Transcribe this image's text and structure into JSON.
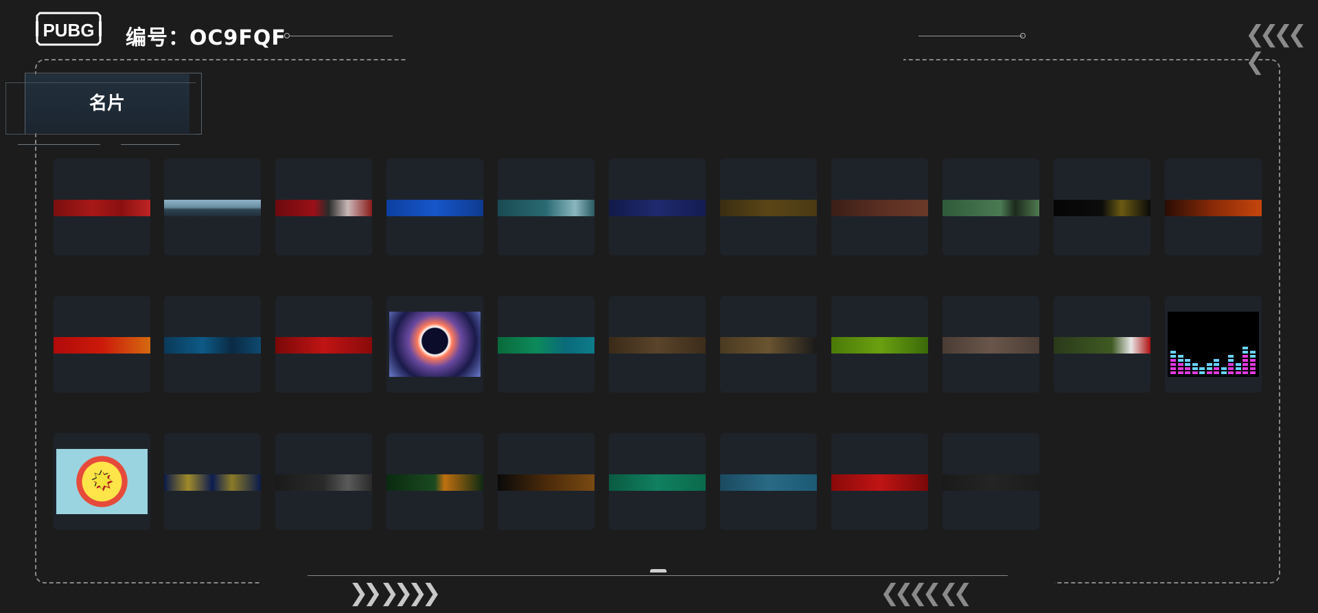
{
  "header": {
    "logo_text": "PUBG",
    "id_label": "编号：OC9FQF"
  },
  "section": {
    "title": "名片"
  },
  "cards": [
    {
      "name": "card-red-pattern",
      "style": "linear-gradient(90deg,#7a0f0f,#a81818 40%,#8a1010 70%,#c02424)"
    },
    {
      "name": "card-mountain",
      "style": "linear-gradient(180deg,#8fb3c8 0%,#6a8fa3 45%,#2f4350 60%,#1f2e38 100%)"
    },
    {
      "name": "card-red-dragon",
      "style": "linear-gradient(90deg,#6b0a0e,#9a1018 40%,#2a2a2a 55%,#c9b7b7 75%,#8a1a1a)"
    },
    {
      "name": "card-blue-tribal",
      "style": "linear-gradient(90deg,#0d3fa0,#1756c9 50%,#0e3a8f)"
    },
    {
      "name": "card-teal-lion",
      "style": "linear-gradient(90deg,#1a4a52,#2a6a72 50%,#8ab6bf 80%,#2b5a62)"
    },
    {
      "name": "card-navy-clouds",
      "style": "linear-gradient(90deg,#121a4a,#1f2a6e 50%,#141c52)"
    },
    {
      "name": "card-bronze-ornate",
      "style": "linear-gradient(90deg,#3a2e12,#5a4516 50%,#4a3a14)"
    },
    {
      "name": "card-brown-swirl",
      "style": "linear-gradient(90deg,#3a1e16,#5a2e22 50%,#6b3a28)"
    },
    {
      "name": "card-green-hand",
      "style": "linear-gradient(90deg,#2f5a3a,#4a7a52 60%,#1c2a1c 75%,#4f7a50)"
    },
    {
      "name": "card-black-gold",
      "style": "linear-gradient(90deg,#050505,#0c0c0c 50%,#6b5a12 70%,#0a0a0a)"
    },
    {
      "name": "card-orange-flourish",
      "style": "linear-gradient(90deg,#2a0d04,#8a2a08 50%,#c4460c)"
    },
    {
      "name": "card-red-orange",
      "style": "linear-gradient(90deg,#b00a0a,#cc1a0a 50%,#d46a10)"
    },
    {
      "name": "card-blue-camo",
      "style": "linear-gradient(90deg,#0a3a5a,#0d5a86 40%,#0a2a44 70%,#0e4a70)"
    },
    {
      "name": "card-crimson-splash",
      "style": "linear-gradient(90deg,#7a0808,#c01414 50%,#8a0a0a)"
    },
    {
      "name": "card-eclipse",
      "style": "thumb-eclipse"
    },
    {
      "name": "card-green-teal",
      "style": "linear-gradient(90deg,#0a6a3a,#0c8a5a 40%,#0a6a7a 70%,#0d7c8a)"
    },
    {
      "name": "card-brown-snake",
      "style": "linear-gradient(90deg,#3a2a18,#5a442a 50%,#3c2c1a)"
    },
    {
      "name": "card-tan-feather",
      "style": "linear-gradient(90deg,#4a3a20,#6a5430 50%,#1a1a1a)"
    },
    {
      "name": "card-lime-green",
      "style": "linear-gradient(90deg,#4a7a08,#6aa010 50%,#3a6a0a)"
    },
    {
      "name": "card-taupe-pattern",
      "style": "linear-gradient(90deg,#4a3c34,#6a564a 50%,#4c3e36)"
    },
    {
      "name": "card-shark-mouth",
      "style": "linear-gradient(90deg,#2a3a1a,#3f5a22 60%,#e6e6e6 80%,#b01010)"
    },
    {
      "name": "card-equalizer",
      "style": "thumb-equalizer"
    },
    {
      "name": "card-bang",
      "style": "thumb-bang"
    },
    {
      "name": "card-navy-gold",
      "style": "linear-gradient(90deg,#0a1a4a,#a08a2a 25%,#0c1c50 50%,#8a7a28 70%,#0a1a4a)"
    },
    {
      "name": "card-dark-knit",
      "style": "linear-gradient(90deg,#1a1a1a,#2a2a2a 50%,#5a5a5a 75%,#2a2a2a)"
    },
    {
      "name": "card-jungle-eye",
      "style": "linear-gradient(90deg,#0a2a10,#1a4a20 50%,#c07010 60%,#0c2a12)"
    },
    {
      "name": "card-tiger-stripe",
      "style": "linear-gradient(90deg,#0a0a0a,#4a2a0a 50%,#7a4a12)"
    },
    {
      "name": "card-green-scale",
      "style": "linear-gradient(90deg,#0a5a40,#108060 50%,#0a6a4a)"
    },
    {
      "name": "card-teal-geo",
      "style": "linear-gradient(90deg,#1a4a60,#2a6a84 50%,#1c5a74)"
    },
    {
      "name": "card-red-diamond",
      "style": "linear-gradient(90deg,#8a0a0a,#c01414 50%,#7a0808)"
    },
    {
      "name": "card-charcoal",
      "style": "linear-gradient(90deg,#1a1a1a,#242424 50%,#1c1c1c)"
    }
  ]
}
